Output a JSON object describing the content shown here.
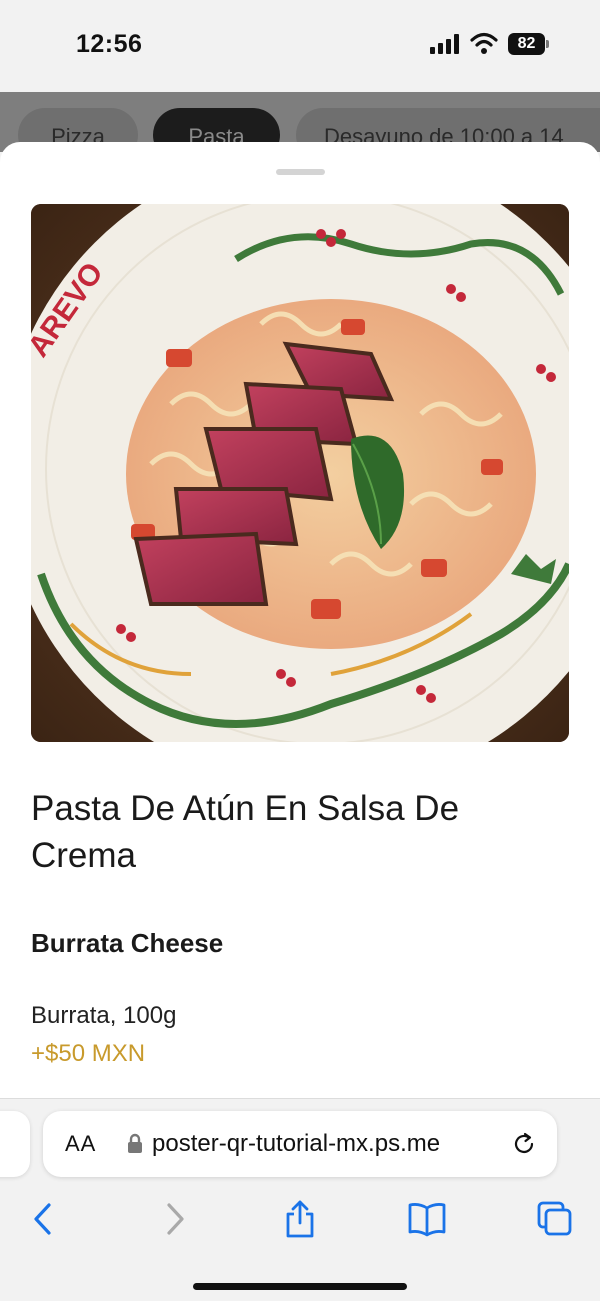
{
  "status_bar": {
    "time": "12:56",
    "battery": "82"
  },
  "categories": [
    {
      "label": "Pizza",
      "active": false
    },
    {
      "label": "Pasta",
      "active": true
    },
    {
      "label": "Desayuno de 10:00 a 14",
      "active": false
    }
  ],
  "product": {
    "title": "Pasta De Atún En Salsa De Crema",
    "plate_text": "AREVO",
    "option_group": "Burrata Cheese",
    "option_name": "Burrata, 100g",
    "option_price": "+$50 MXN"
  },
  "browser": {
    "text_size_label": "AA",
    "url": "poster-qr-tutorial-mx.ps.me",
    "accent_color": "#1a73e8",
    "toolbar": [
      "back-icon",
      "forward-icon",
      "share-icon",
      "bookmarks-icon",
      "tabs-icon"
    ]
  }
}
